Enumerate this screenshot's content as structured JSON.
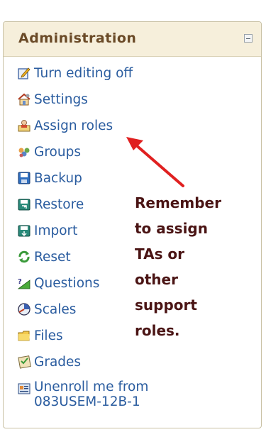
{
  "block": {
    "title": "Administration",
    "items": [
      {
        "label": "Turn editing off",
        "icon": "pencil-edit-icon"
      },
      {
        "label": "Settings",
        "icon": "settings-house-icon"
      },
      {
        "label": "Assign roles",
        "icon": "assign-roles-icon"
      },
      {
        "label": "Groups",
        "icon": "groups-icon"
      },
      {
        "label": "Backup",
        "icon": "backup-icon"
      },
      {
        "label": "Restore",
        "icon": "restore-icon"
      },
      {
        "label": "Import",
        "icon": "import-icon"
      },
      {
        "label": "Reset",
        "icon": "reset-icon"
      },
      {
        "label": "Questions",
        "icon": "questions-icon"
      },
      {
        "label": "Scales",
        "icon": "scales-icon"
      },
      {
        "label": "Files",
        "icon": "folder-icon"
      },
      {
        "label": "Grades",
        "icon": "grades-icon"
      },
      {
        "label": "Unenroll me from 083USEM-12B-1",
        "icon": "unenroll-icon"
      }
    ]
  },
  "annotation": {
    "lines": [
      "Remember",
      "to assign",
      "TAs or",
      "other",
      "support",
      "roles."
    ],
    "color": "#4a1414",
    "arrow_color": "#e02020"
  }
}
